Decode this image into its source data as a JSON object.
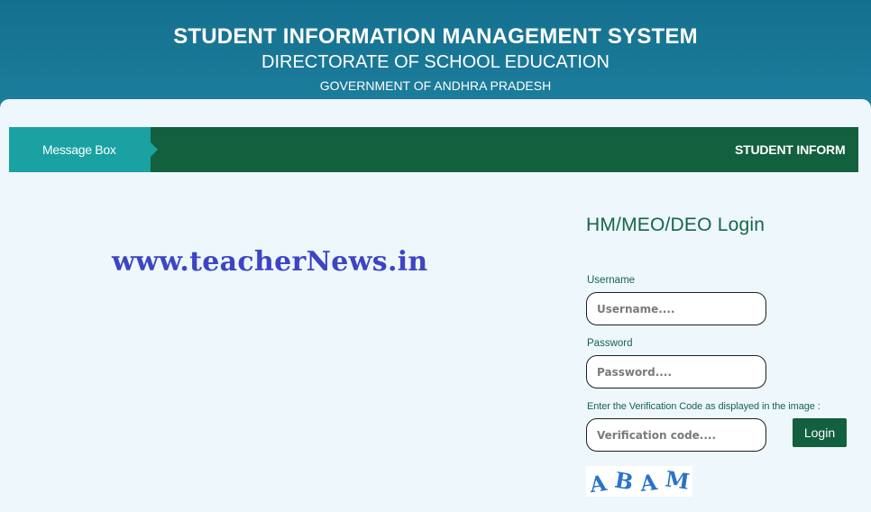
{
  "header": {
    "title": "STUDENT INFORMATION MANAGEMENT SYSTEM",
    "subtitle": "DIRECTORATE OF SCHOOL EDUCATION",
    "government": "GOVERNMENT OF ANDHRA PRADESH"
  },
  "message_bar": {
    "label": "Message Box",
    "marquee": "STUDENT INFORM"
  },
  "watermark": "www.teacherNews.in",
  "login": {
    "title": "HM/MEO/DEO Login",
    "username_label": "Username",
    "username_placeholder": "Username....",
    "password_label": "Password",
    "password_placeholder": "Password....",
    "code_label": "Enter the Verification Code as displayed in the image :",
    "code_placeholder": "Verification code....",
    "button": "Login",
    "captcha": [
      "A",
      "B",
      "A",
      "M"
    ]
  },
  "colors": {
    "header": "#15708f",
    "message_bar": "#12603e",
    "message_label": "#1aa1a1",
    "accent_green": "#16654a",
    "watermark": "#3d45c4",
    "captcha": "#2a73c9"
  }
}
